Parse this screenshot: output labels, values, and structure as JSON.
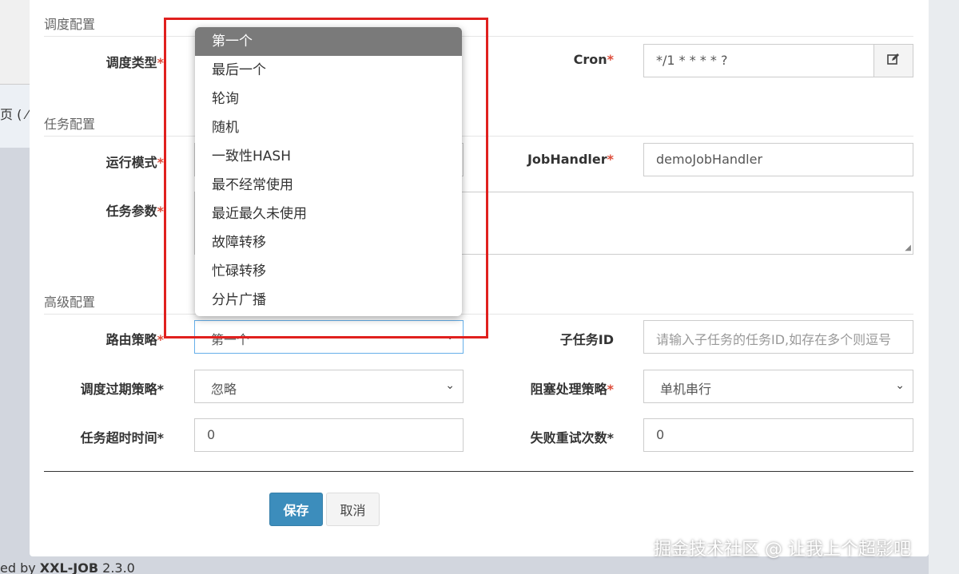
{
  "background": {
    "breadcrumb": "页 ( ⁄",
    "footer_prefix": "ed by ",
    "footer_brand": "XXL-JOB",
    "footer_version": " 2.3.0"
  },
  "sections": {
    "schedule": "调度配置",
    "task": "任务配置",
    "advanced": "高级配置"
  },
  "fields": {
    "schedule_type_label": "调度类型",
    "cron_label": "Cron",
    "cron_value": "*/1 * * * * ?",
    "run_mode_label": "运行模式",
    "jobhandler_label": "JobHandler",
    "jobhandler_value": "demoJobHandler",
    "task_params_label": "任务参数",
    "route_strategy_label": "路由策略",
    "route_strategy_value": "第一个",
    "child_task_label": "子任务ID",
    "child_task_placeholder": "请输入子任务的任务ID,如存在多个则逗号",
    "misfire_label": "调度过期策略",
    "misfire_value": "忽略",
    "block_strategy_label": "阻塞处理策略",
    "block_strategy_value": "单机串行",
    "timeout_label": "任务超时时间",
    "timeout_value": "0",
    "retry_label": "失败重试次数",
    "retry_value": "0",
    "required_mark": "*"
  },
  "buttons": {
    "save": "保存",
    "cancel": "取消"
  },
  "dropdown": {
    "options": [
      "第一个",
      "最后一个",
      "轮询",
      "随机",
      "一致性HASH",
      "最不经常使用",
      "最近最久未使用",
      "故障转移",
      "忙碌转移",
      "分片广播"
    ],
    "selected_index": 0
  },
  "watermark": "掘金技术社区 @ 让我上个超影吧",
  "colors": {
    "primary": "#3c8dbc",
    "required": "#dd4b39",
    "highlight_box": "#e0201e",
    "selected_option": "#7a7a7a"
  }
}
